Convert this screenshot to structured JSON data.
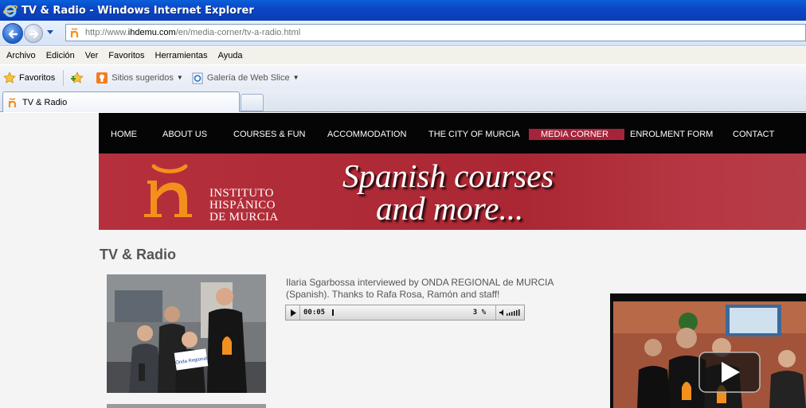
{
  "window": {
    "title": "TV & Radio - Windows Internet Explorer"
  },
  "address": {
    "url_prefix": "http://www.",
    "url_host": "ihdemu.com",
    "url_path": "/en/media-corner/tv-a-radio.html"
  },
  "menu": [
    "Archivo",
    "Edición",
    "Ver",
    "Favoritos",
    "Herramientas",
    "Ayuda"
  ],
  "favorites_bar": {
    "favorites_label": "Favoritos",
    "suggested_sites": "Sitios sugeridos",
    "web_slice": "Galería de Web Slice"
  },
  "tab": {
    "label": "TV & Radio"
  },
  "site_nav": [
    "HOME",
    "ABOUT US",
    "COURSES & FUN",
    "ACCOMMODATION",
    "THE CITY OF MURCIA",
    "MEDIA CORNER",
    "ENROLMENT FORM",
    "CONTACT"
  ],
  "site_nav_active": "MEDIA CORNER",
  "banner": {
    "institute_line1": "INSTITUTO",
    "institute_line2": "HISPÁNICO",
    "institute_line3": "DE MURCIA",
    "tagline_line1": "Spanish courses",
    "tagline_line2": "and more..."
  },
  "page": {
    "heading": "TV & Radio",
    "caption": "Ilaria Sgarbossa interviewed by ONDA REGIONAL de MURCIA (Spanish). Thanks to Rafa Rosa, Ramón and staff!",
    "photo_sign_text": "Onda Regional"
  },
  "audio_player": {
    "time": "00:05",
    "percent": "3 %",
    "progress": 0.03
  },
  "colors": {
    "nav_active": "#a6243a",
    "banner_red": "#ad2a35",
    "logo_orange": "#f3901d"
  }
}
